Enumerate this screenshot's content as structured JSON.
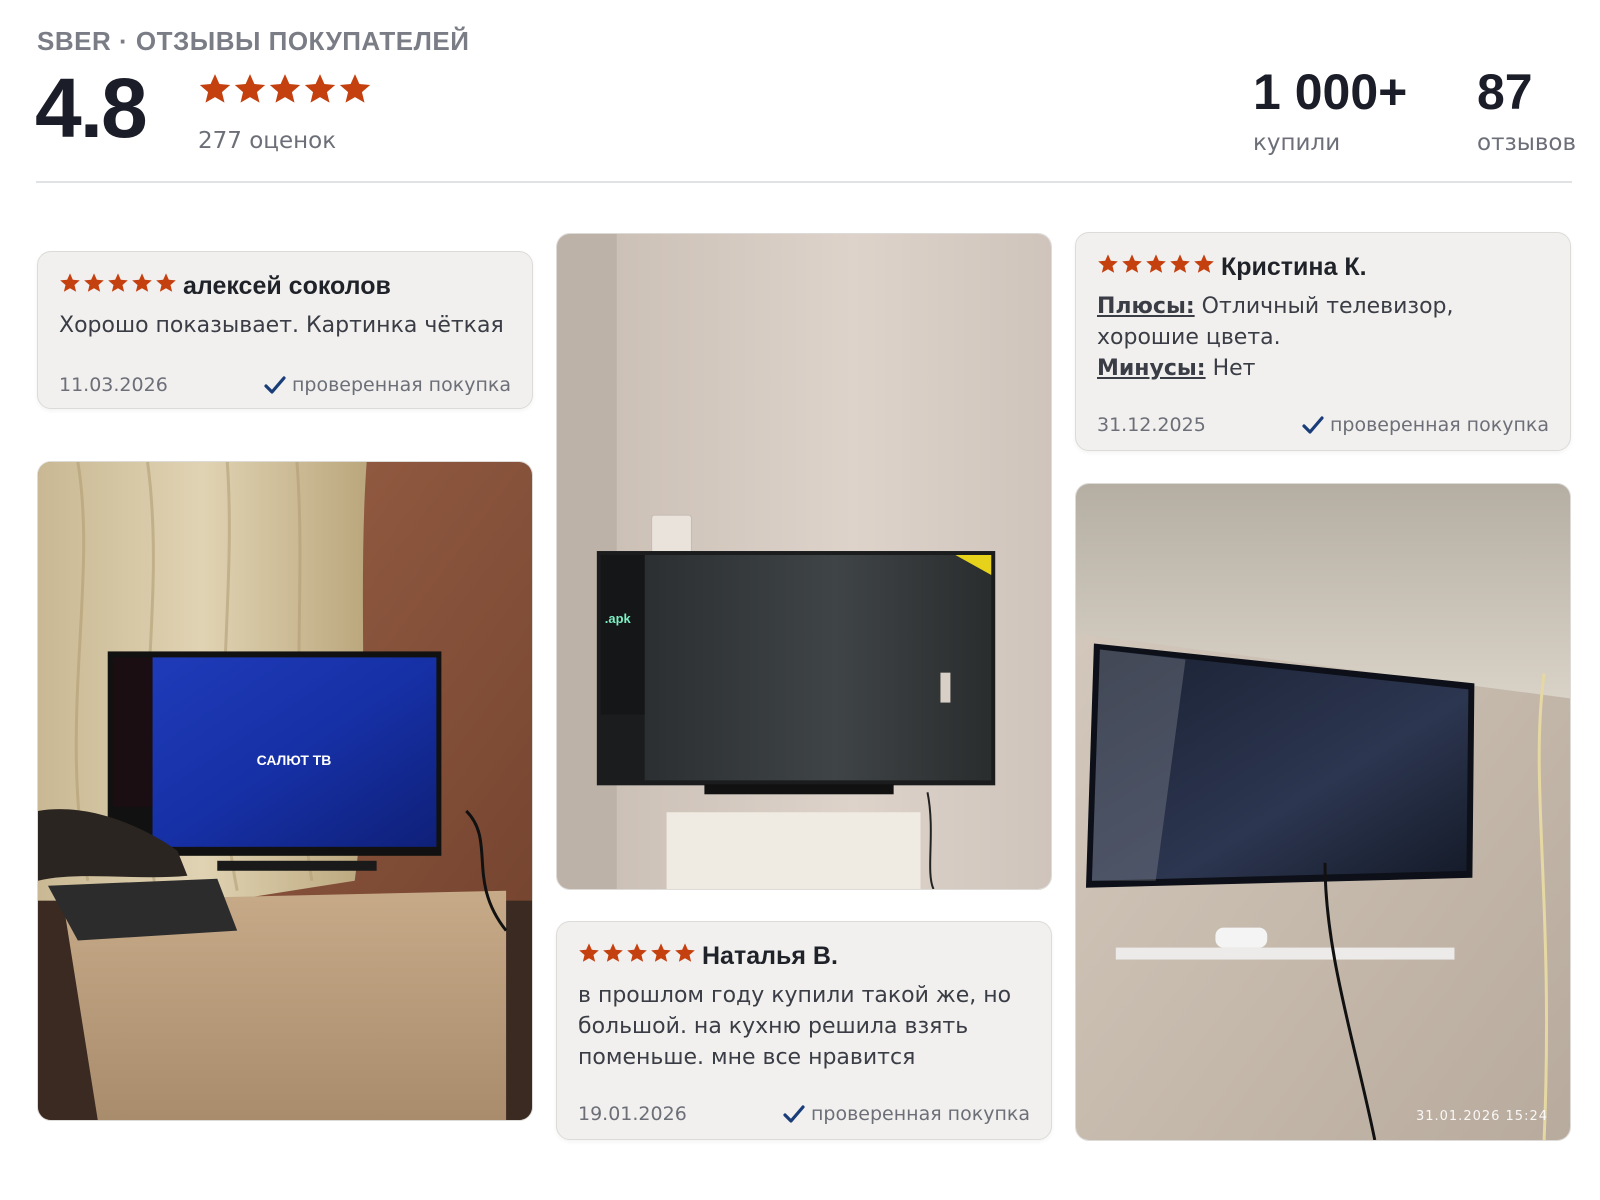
{
  "header": {
    "brand": "SBER · ОТЗЫВЫ ПОКУПАТЕЛЕЙ",
    "rating": "4.8",
    "rating_count": "277 оценок",
    "bought_value": "1 000+",
    "bought_label": "купили",
    "reviews_value": "87",
    "reviews_label": "отзывов",
    "star_count": 5
  },
  "colors": {
    "star": "#c4400f",
    "card_bg": "#f1f0ee",
    "check": "#1a3d7a",
    "text": "#1f2229",
    "muted": "#6c6f78"
  },
  "reviews": [
    {
      "author": "алексей соколов",
      "stars": 5,
      "text": "Хорошо показывает. Картинка чёткая",
      "date": "11.03.2026",
      "verified": "проверенная покупка"
    },
    {
      "author": "Кристина К.",
      "stars": 5,
      "pros_label": "Плюсы:",
      "pros_text": "Отличный телевизор, хорошие цвета.",
      "cons_label": "Минусы:",
      "cons_text": "Нет",
      "date": "31.12.2025",
      "verified": "проверенная покупка"
    },
    {
      "author": "Наталья В.",
      "stars": 5,
      "text": "в прошлом году купили такой же, но большой. на кухню решила взять поменьше. мне все нравится",
      "date": "19.01.2026",
      "verified": "проверенная покупка"
    }
  ],
  "photos": {
    "photo1": {
      "screen_text": "САЛЮТ ТВ"
    },
    "photo2": {
      "side_label": ".apk"
    },
    "photo3": {
      "timestamp": "31.01.2026  15:24"
    }
  },
  "icons": {
    "star": "star-icon",
    "verified": "checkmark-icon"
  }
}
